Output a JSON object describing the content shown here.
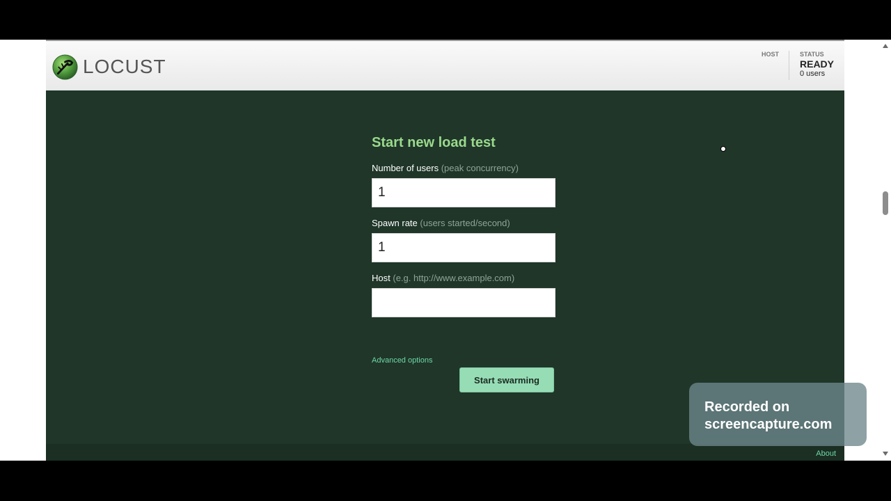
{
  "header": {
    "logo_text": "LOCUST",
    "host_label": "HOST",
    "status_label": "STATUS",
    "status_value": "READY",
    "users_text": "0 users"
  },
  "form": {
    "title": "Start new load test",
    "users": {
      "label": "Number of users",
      "hint": "(peak concurrency)",
      "value": "1"
    },
    "spawn_rate": {
      "label": "Spawn rate",
      "hint": "(users started/second)",
      "value": "1"
    },
    "host": {
      "label": "Host",
      "hint": "(e.g. http://www.example.com)",
      "value": ""
    },
    "advanced_options": "Advanced options",
    "start_button": "Start swarming"
  },
  "footer": {
    "about": "About"
  },
  "watermark": {
    "line1": "Recorded on",
    "line2": "screencapture.com"
  },
  "icons": [
    "locust-logo-icon",
    "scroll-up-icon",
    "scroll-down-icon",
    "cursor-icon"
  ],
  "colors": {
    "page_bg": "#1f3629",
    "title_green": "#9bd98c",
    "link_green": "#6fd6a6",
    "button_bg": "#96ddb6"
  }
}
